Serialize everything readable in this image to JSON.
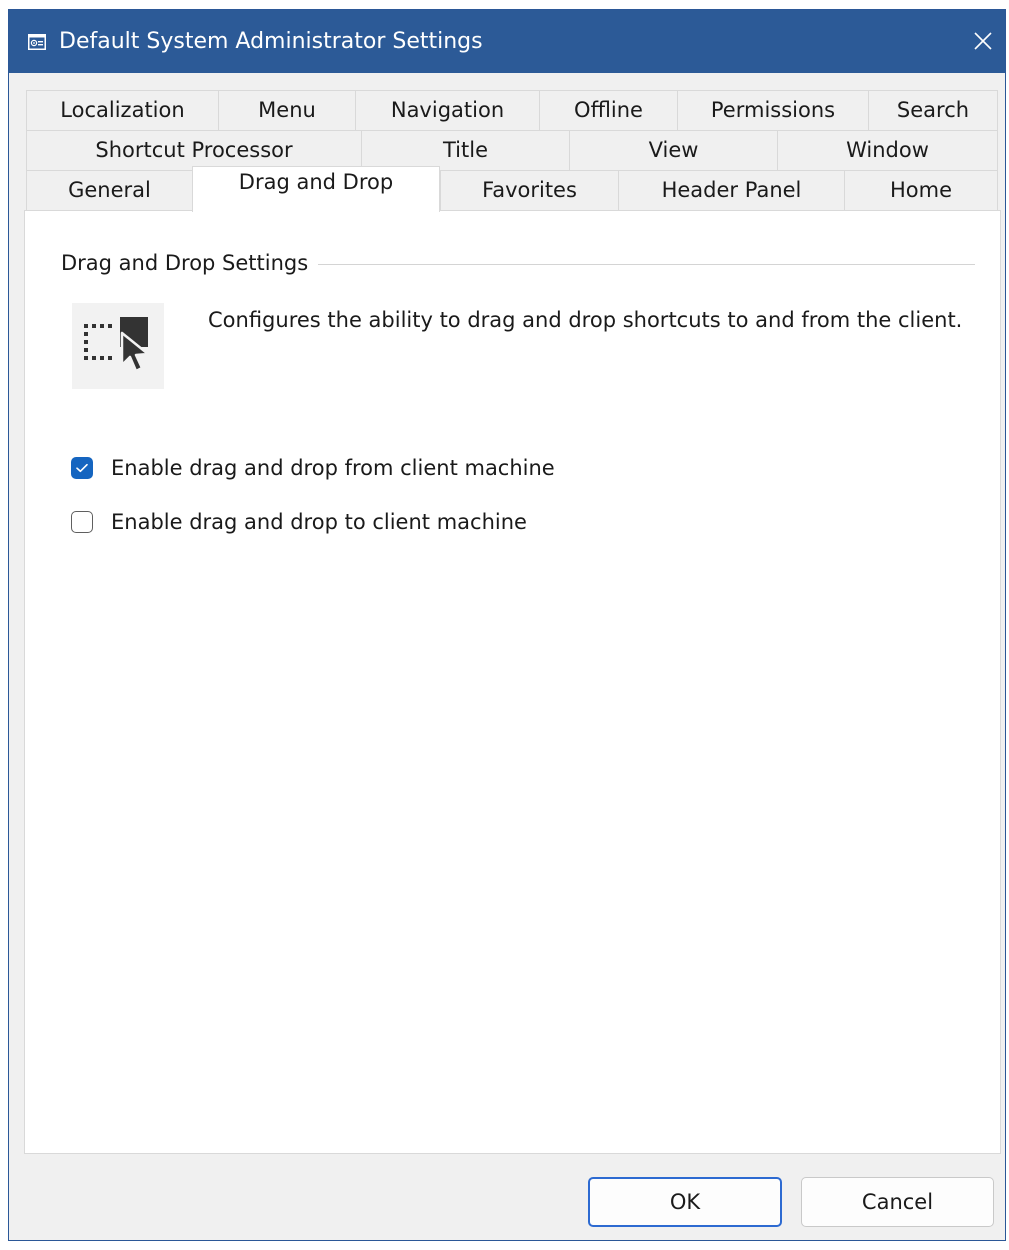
{
  "window": {
    "title": "Default System Administrator Settings",
    "titlebar_color": "#2c5a97",
    "accent_color": "#1565c0"
  },
  "tabs": {
    "row1": [
      "Localization",
      "Menu",
      "Navigation",
      "Offline",
      "Permissions",
      "Search"
    ],
    "row2": [
      "Shortcut Processor",
      "Title",
      "View",
      "Window"
    ],
    "row3": [
      "General",
      "Drag and Drop",
      "Favorites",
      "Header Panel",
      "Home"
    ],
    "active": "Drag and Drop"
  },
  "panel": {
    "group_label": "Drag and Drop Settings",
    "icon": "drag-drop-icon",
    "description": "Configures the ability to drag and drop shortcuts to and from the client.",
    "options": [
      {
        "label": "Enable drag and drop from client machine",
        "checked": true
      },
      {
        "label": "Enable drag and drop to client machine",
        "checked": false
      }
    ]
  },
  "buttons": {
    "ok": "OK",
    "cancel": "Cancel"
  }
}
